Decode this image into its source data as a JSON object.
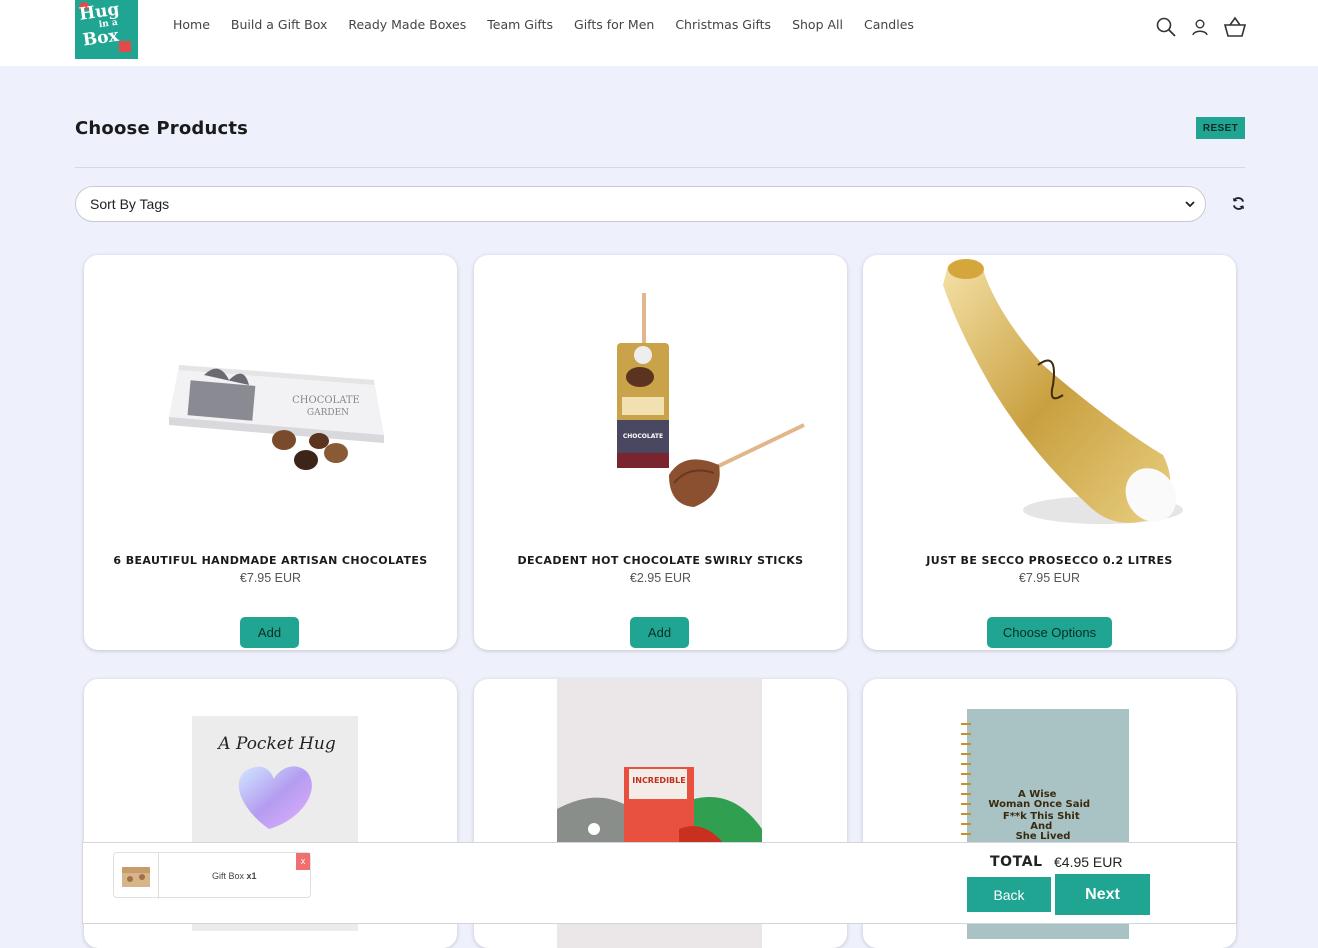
{
  "header": {
    "logo_text_line1": "Hug",
    "logo_text_line2": "Box",
    "nav": [
      "Home",
      "Build a Gift Box",
      "Ready Made Boxes",
      "Team Gifts",
      "Gifts for Men",
      "Christmas Gifts",
      "Shop All",
      "Candles"
    ],
    "icons": [
      "search-icon",
      "account-icon",
      "basket-icon"
    ]
  },
  "page": {
    "title": "Choose Products",
    "reset_label": "RESET",
    "sort_value": "Sort By Tags"
  },
  "products": [
    {
      "name": "6 BEAUTIFUL HANDMADE ARTISAN CHOCOLATES",
      "price": "€7.95 EUR",
      "button": "Add"
    },
    {
      "name": "DECADENT HOT CHOCOLATE SWIRLY STICKS",
      "price": "€2.95 EUR",
      "button": "Add"
    },
    {
      "name": "JUST BE SECCO PROSECCO 0.2 LITRES",
      "price": "€7.95 EUR",
      "button": "Choose Options"
    },
    {
      "name": "",
      "price": "",
      "button": ""
    },
    {
      "name": "",
      "price": "",
      "button": ""
    },
    {
      "name": "",
      "price": "",
      "button": ""
    }
  ],
  "product_images": {
    "pocket_hug_text": "A Pocket Hug",
    "socks_text": "INCREDIBLE",
    "notebook_text": [
      "A Wise",
      "Woman Once Said",
      "F**k This Shit",
      "And",
      "She Lived"
    ]
  },
  "bottom_bar": {
    "box_label": "Gift Box",
    "box_qty": "x1",
    "remove_label": "x",
    "total_label": "TOTAL",
    "total_value": "€4.95 EUR",
    "back_label": "Back",
    "next_label": "Next"
  },
  "colors": {
    "accent": "#1fa592",
    "background": "#eef0fb",
    "remove": "#f07070"
  }
}
